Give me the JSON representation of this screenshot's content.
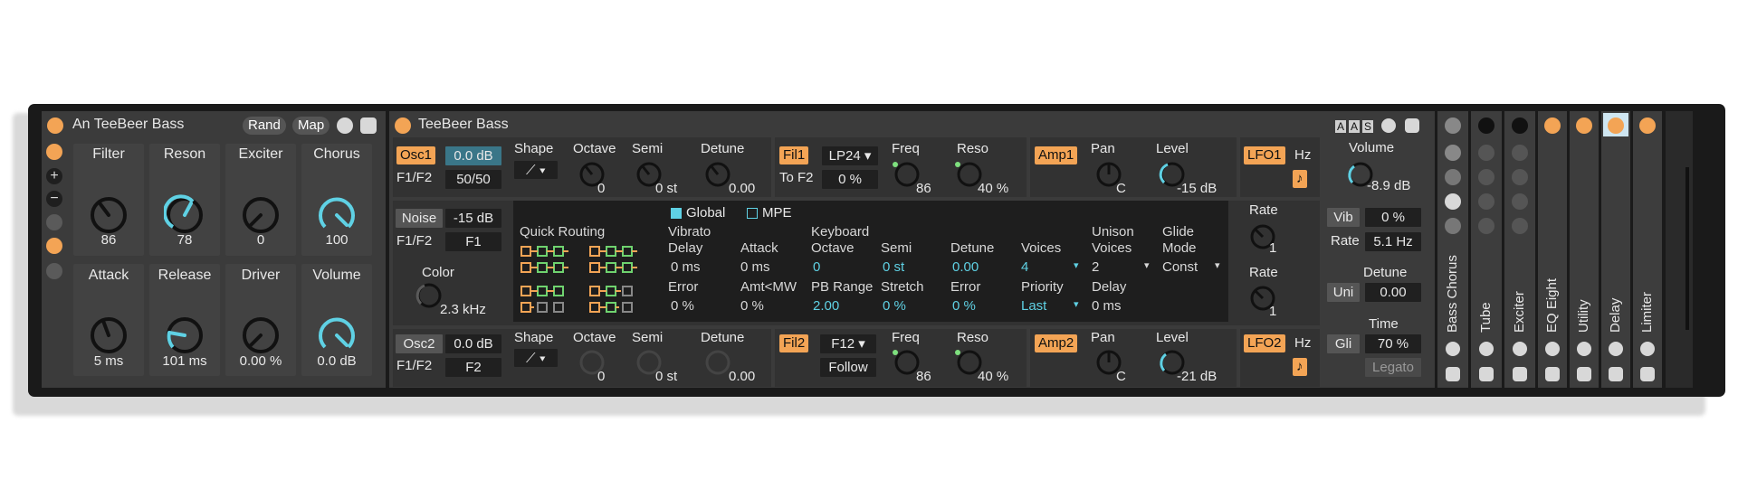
{
  "rack": {
    "title": "An TeeBeer Bass",
    "rand_label": "Rand",
    "map_label": "Map",
    "macros": [
      {
        "name": "Filter",
        "value": "86"
      },
      {
        "name": "Reson",
        "value": "78"
      },
      {
        "name": "Exciter",
        "value": "0"
      },
      {
        "name": "Chorus",
        "value": "100"
      },
      {
        "name": "Attack",
        "value": "5 ms"
      },
      {
        "name": "Release",
        "value": "101 ms"
      },
      {
        "name": "Driver",
        "value": "0.00 %"
      },
      {
        "name": "Volume",
        "value": "0.0 dB"
      }
    ]
  },
  "synth": {
    "title": "TeeBeer Bass",
    "osc1": {
      "label": "Osc1",
      "level": "0.0 dB",
      "f1f2_label": "F1/F2",
      "f1f2": "50/50",
      "shape_label": "Shape",
      "octave_label": "Octave",
      "octave": "0",
      "semi_label": "Semi",
      "semi": "0 st",
      "detune_label": "Detune",
      "detune": "0.00"
    },
    "osc2": {
      "label": "Osc2",
      "level": "0.0 dB",
      "f1f2_label": "F1/F2",
      "f1f2": "F2",
      "shape_label": "Shape",
      "octave_label": "Octave",
      "octave": "0",
      "semi_label": "Semi",
      "semi": "0 st",
      "detune_label": "Detune",
      "detune": "0.00"
    },
    "noise": {
      "label": "Noise",
      "level": "-15 dB",
      "f1f2_label": "F1/F2",
      "f1f2": "F1",
      "color_label": "Color",
      "color": "2.3 kHz"
    },
    "fil1": {
      "label": "Fil1",
      "type": "LP24",
      "to_f2_label": "To F2",
      "to_f2": "0 %",
      "freq_label": "Freq",
      "freq": "86",
      "reso_label": "Reso",
      "reso": "40 %"
    },
    "fil2": {
      "label": "Fil2",
      "type": "F12",
      "follow_label": "Follow",
      "freq_label": "Freq",
      "freq": "86",
      "reso_label": "Reso",
      "reso": "40 %"
    },
    "amp1": {
      "label": "Amp1",
      "pan_label": "Pan",
      "pan": "C",
      "level_label": "Level",
      "level": "-15 dB"
    },
    "amp2": {
      "label": "Amp2",
      "pan_label": "Pan",
      "pan": "C",
      "level_label": "Level",
      "level": "-21 dB"
    },
    "lfo1": {
      "label": "LFO1",
      "unit": "Hz",
      "rate_label": "Rate",
      "rate": "1"
    },
    "lfo2": {
      "label": "LFO2",
      "unit": "Hz",
      "rate_label": "Rate",
      "rate": "1"
    },
    "global": {
      "global_tab": "Global",
      "mpe_tab": "MPE",
      "quick_routing": "Quick Routing",
      "vibrato": "Vibrato",
      "delay_label": "Delay",
      "delay": "0 ms",
      "attack_label": "Attack",
      "attack": "0 ms",
      "error_label": "Error",
      "error": "0 %",
      "amt_mw_label": "Amt<MW",
      "amt_mw": "0 %",
      "keyboard": "Keyboard",
      "octave_label": "Octave",
      "octave": "0",
      "semi_label": "Semi",
      "semi": "0 st",
      "detune_label": "Detune",
      "detune": "0.00",
      "voices_label": "Voices",
      "voices": "4",
      "pb_range_label": "PB Range",
      "pb_range": "2.00",
      "stretch_label": "Stretch",
      "stretch": "0 %",
      "kerror_label": "Error",
      "kerror": "0 %",
      "priority_label": "Priority",
      "priority": "Last",
      "unison_label": "Unison",
      "unison_voices_label": "Voices",
      "unison_voices": "2",
      "unison_delay_label": "Delay",
      "unison_delay": "0 ms",
      "glide_label": "Glide",
      "glide_mode_label": "Mode",
      "glide_mode": "Const"
    },
    "master": {
      "volume_label": "Volume",
      "volume": "-8.9 dB",
      "vib_label": "Vib",
      "vib": "0 %",
      "rate_label": "Rate",
      "rate": "5.1 Hz",
      "uni_label": "Uni",
      "detune_label": "Detune",
      "detune": "0.00",
      "gli_label": "Gli",
      "time_label": "Time",
      "time": "70 %",
      "legato_label": "Legato",
      "header_a1": "A",
      "header_a2": "A",
      "header_s": "S"
    }
  },
  "devices": [
    "Bass Chorus",
    "Tube",
    "Exciter",
    "EQ Eight",
    "Utility",
    "Delay",
    "Limiter"
  ],
  "colors": {
    "accent": "#f3a455",
    "cyan": "#5fd1e4",
    "panel": "#3b3b3b",
    "frame": "#1a1a1a"
  }
}
